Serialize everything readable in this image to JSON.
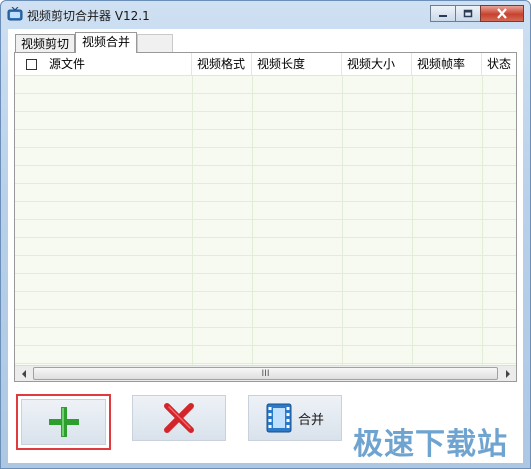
{
  "window": {
    "title": "视频剪切合并器 V12.1"
  },
  "tabs": [
    {
      "label": "视频剪切",
      "active": false
    },
    {
      "label": "视频合并",
      "active": true
    }
  ],
  "table": {
    "columns": [
      "源文件",
      "视频格式",
      "视频长度",
      "视频大小",
      "视频帧率",
      "状态"
    ],
    "rows": []
  },
  "scrollbar": {
    "thumb_grip": "III"
  },
  "buttons": {
    "add": {
      "icon": "plus-icon",
      "color": "#2e9e2e"
    },
    "remove": {
      "icon": "x-icon",
      "color": "#d3262b"
    },
    "merge": {
      "icon": "film-icon",
      "label": "合并"
    }
  },
  "watermark": {
    "text": "极速下载站",
    "color": "#6fa3d0"
  }
}
